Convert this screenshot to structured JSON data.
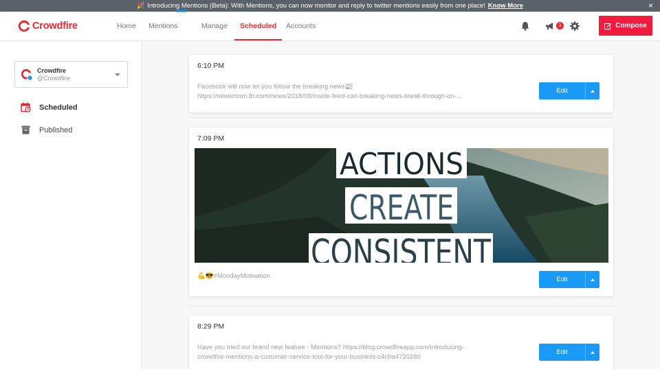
{
  "announcement": {
    "emoji": "🎉",
    "text": "Introducing Mentions (Beta): With Mentions, you can now monitor and reply to twitter mentions easily from one place!",
    "link": "Know More",
    "close": "×"
  },
  "brand": {
    "name": "Crowdfire",
    "color": "#e8272f"
  },
  "nav": {
    "home": "Home",
    "mentions": "Mentions",
    "mentions_badge": "New",
    "manage": "Manage",
    "scheduled": "Scheduled",
    "accounts": "Accounts"
  },
  "header": {
    "notification_count": "3",
    "compose_label": "Compose"
  },
  "sidebar": {
    "account": {
      "name": "Crowdfire",
      "handle": "@Crowdfire"
    },
    "links": {
      "scheduled": "Scheduled",
      "published": "Published"
    }
  },
  "posts": [
    {
      "time": "6:10 PM",
      "text_line1": "Facebook will now let you follow the breaking news📰",
      "text_line2": "https://newsroom.fb.com/news/2018/08/inside-feed-can-breaking-news-break-through-on-...",
      "edit_label": "Edit"
    },
    {
      "time": "7:09 PM",
      "image_words": [
        "ACTIONS",
        "CREATE",
        "CONSISTENT"
      ],
      "text_line1": "💪😎#MondayMotivation",
      "edit_label": "Edit"
    },
    {
      "time": "8:29 PM",
      "text_line1": "Have you tried our brand new feature - Mentions? https://blog.crowdfireapp.com/introducing-",
      "text_line2": "crowdfire-mentions-a-customer-service-tool-for-your-business-c4cba4720280",
      "edit_label": "Edit"
    }
  ],
  "colors": {
    "accent": "#1a9af7",
    "compose": "#f21b3f",
    "announce_bg": "#5b6168"
  }
}
